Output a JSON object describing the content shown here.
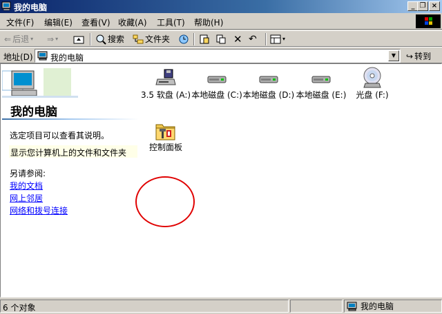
{
  "window": {
    "title": "我的电脑"
  },
  "titlebar_buttons": [
    "_",
    "❐",
    "×"
  ],
  "menu": [
    "文件(F)",
    "编辑(E)",
    "查看(V)",
    "收藏(A)",
    "工具(T)",
    "帮助(H)"
  ],
  "toolbar": {
    "back": "后退",
    "search": "搜索",
    "folders": "文件夹"
  },
  "address": {
    "label": "地址(D)",
    "value": "我的电脑",
    "go": "转到"
  },
  "sidebar": {
    "title": "我的电脑",
    "description": "选定项目可以查看其说明。",
    "hint": "显示您计算机上的文件和文件夹",
    "see_also": "另请参阅:",
    "links": [
      "我的文档",
      "网上邻居",
      "网络和拨号连接"
    ]
  },
  "drives": [
    {
      "label": "3.5 软盘 (A:)",
      "icon": "floppy-drive-icon"
    },
    {
      "label": "本地磁盘 (C:)",
      "icon": "hard-disk-icon"
    },
    {
      "label": "本地磁盘 (D:)",
      "icon": "hard-disk-icon"
    },
    {
      "label": "本地磁盘 (E:)",
      "icon": "hard-disk-icon"
    },
    {
      "label": "光盘 (F:)",
      "icon": "cd-drive-icon"
    }
  ],
  "control_panel": {
    "label": "控制面板",
    "icon": "control-panel-folder-icon"
  },
  "status": {
    "count": "6 个对象",
    "location": "我的电脑"
  },
  "colors": {
    "title_gradient_start": "#0a246a",
    "title_gradient_end": "#a6caf0",
    "link": "#0000ff",
    "highlight_circle": "#e00000"
  }
}
